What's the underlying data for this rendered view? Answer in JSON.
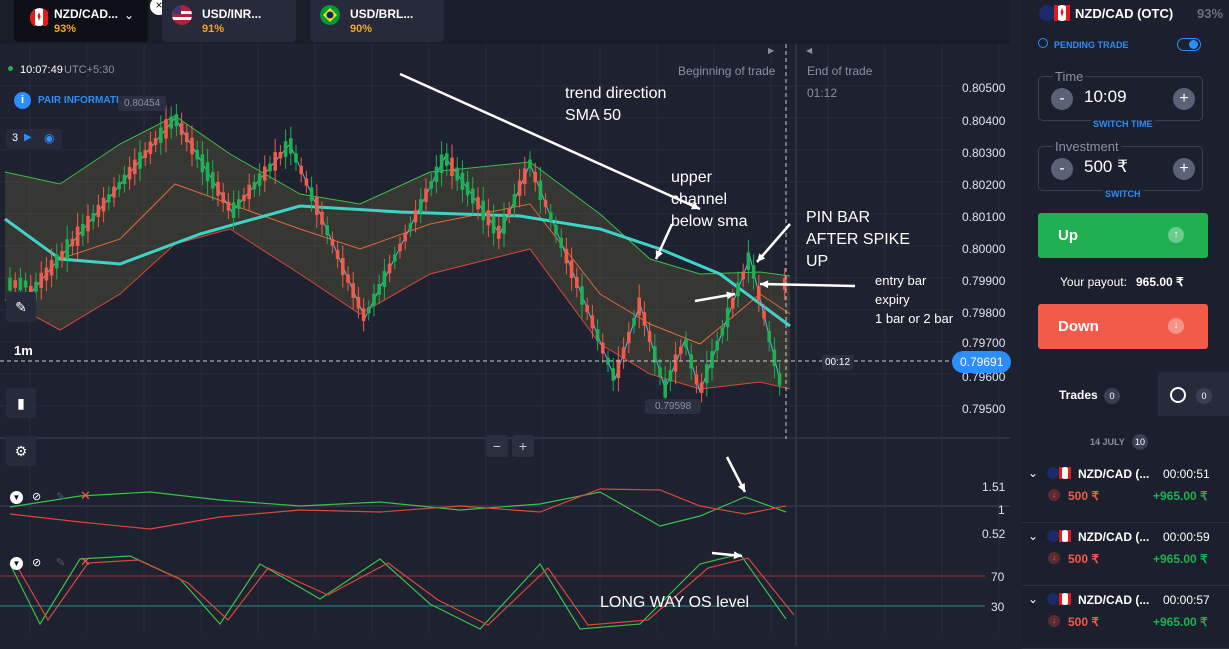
{
  "tabs": [
    {
      "name": "NZD/CAD...",
      "pct": "93%",
      "active": true
    },
    {
      "name": "USD/INR...",
      "pct": "91%",
      "active": false
    },
    {
      "name": "USD/BRL...",
      "pct": "90%",
      "active": false
    }
  ],
  "clock": {
    "time": "10:07:49",
    "tz": "UTC+5:30"
  },
  "pair_info": "PAIR INFORMATION",
  "price_high_label": "0.80454",
  "price_low_label": "0.79598",
  "indicator_count": "3",
  "timeframe": "1m",
  "trade_labels": {
    "begin": "Beginning of trade",
    "end": "End of trade",
    "countdown": "01:12"
  },
  "current_price": "0.79691",
  "timer": "00:12",
  "price_axis": [
    "0.80500",
    "0.80400",
    "0.80300",
    "0.80200",
    "0.80100",
    "0.80000",
    "0.79900",
    "0.79800",
    "0.79700",
    "0.79600",
    "0.79500"
  ],
  "osc1_axis": [
    "1.51",
    "1",
    "0.52"
  ],
  "osc2_axis": [
    "70",
    "30"
  ],
  "zoom": {
    "minus": "−",
    "plus": "+"
  },
  "annotations": {
    "trend": "trend direction\nSMA 50",
    "upper": "upper\nchannel\nbelow sma",
    "pin": "PIN BAR\nAFTER SPIKE\nUP",
    "entry": "entry bar\nexpiry\n1 bar or 2 bar",
    "os": "LONG WAY OS level"
  },
  "sidebar": {
    "pair": "NZD/CAD (OTC)",
    "payout_pct": "93%",
    "pending": "PENDING TRADE",
    "time_label": "Time",
    "time_value": "10:09",
    "switch_time": "SWITCH TIME",
    "invest_label": "Investment",
    "invest_value": "500 ₹",
    "switch": "SWITCH",
    "up": "Up",
    "payout_label": "Your payout:",
    "payout_value": "965.00 ₹",
    "down": "Down"
  },
  "trades": {
    "tab_label": "Trades",
    "count": "0",
    "history_count": "0",
    "date": "14 JULY",
    "date_count": "10",
    "rows": [
      {
        "pair": "NZD/CAD (...",
        "time": "00:00:51",
        "amount": "500 ₹",
        "profit": "+965.00 ₹"
      },
      {
        "pair": "NZD/CAD (...",
        "time": "00:00:59",
        "amount": "500 ₹",
        "profit": "+965.00 ₹"
      },
      {
        "pair": "NZD/CAD (...",
        "time": "00:00:57",
        "amount": "500 ₹",
        "profit": "+965.00 ₹"
      }
    ]
  },
  "colors": {
    "up": "#1fb052",
    "down": "#f25a4a",
    "accent": "#2c8ef8",
    "payout": "#f5a623"
  }
}
